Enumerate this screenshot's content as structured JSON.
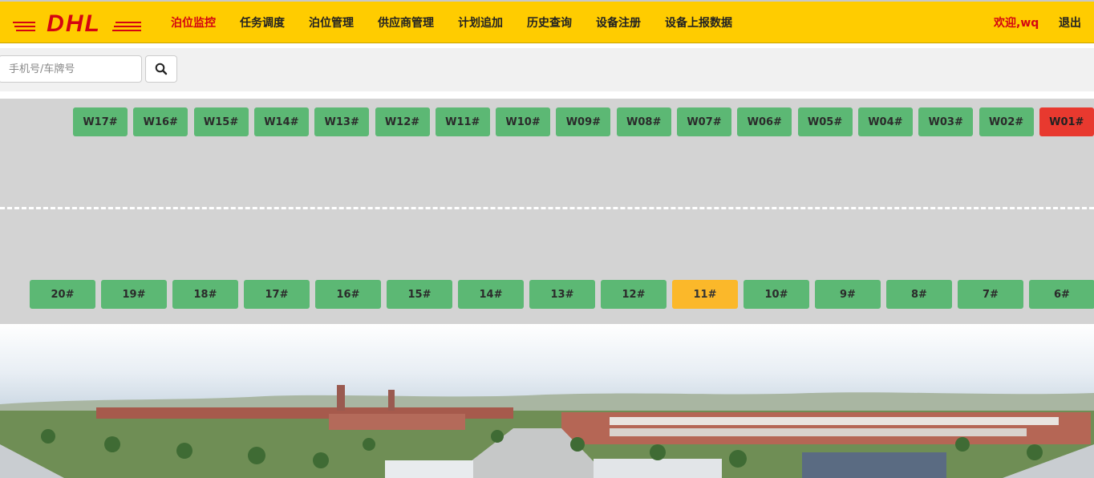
{
  "brand": {
    "logo_text": "DHL",
    "brand_yellow": "#ffcc00",
    "brand_red": "#d40511"
  },
  "nav": {
    "items": [
      {
        "label": "泊位监控",
        "active": true
      },
      {
        "label": "任务调度",
        "active": false
      },
      {
        "label": "泊位管理",
        "active": false
      },
      {
        "label": "供应商管理",
        "active": false
      },
      {
        "label": "计划追加",
        "active": false
      },
      {
        "label": "历史查询",
        "active": false
      },
      {
        "label": "设备注册",
        "active": false
      },
      {
        "label": "设备上报数据",
        "active": false
      }
    ],
    "welcome": "欢迎,wq",
    "logout": "退出"
  },
  "search": {
    "placeholder": "手机号/车牌号",
    "value": "",
    "button_icon": "search-icon"
  },
  "status_colors": {
    "free": "#5cb874",
    "occupied": "#e8392f",
    "pending": "#fbb82a"
  },
  "top_row": [
    {
      "label": "W17#",
      "status": "free"
    },
    {
      "label": "W16#",
      "status": "free"
    },
    {
      "label": "W15#",
      "status": "free"
    },
    {
      "label": "W14#",
      "status": "free"
    },
    {
      "label": "W13#",
      "status": "free"
    },
    {
      "label": "W12#",
      "status": "free"
    },
    {
      "label": "W11#",
      "status": "free"
    },
    {
      "label": "W10#",
      "status": "free"
    },
    {
      "label": "W09#",
      "status": "free"
    },
    {
      "label": "W08#",
      "status": "free"
    },
    {
      "label": "W07#",
      "status": "free"
    },
    {
      "label": "W06#",
      "status": "free"
    },
    {
      "label": "W05#",
      "status": "free"
    },
    {
      "label": "W04#",
      "status": "free"
    },
    {
      "label": "W03#",
      "status": "free"
    },
    {
      "label": "W02#",
      "status": "free"
    },
    {
      "label": "W01#",
      "status": "occupied"
    }
  ],
  "bottom_row": [
    {
      "label": "20#",
      "status": "free"
    },
    {
      "label": "19#",
      "status": "free"
    },
    {
      "label": "18#",
      "status": "free"
    },
    {
      "label": "17#",
      "status": "free"
    },
    {
      "label": "16#",
      "status": "free"
    },
    {
      "label": "15#",
      "status": "free"
    },
    {
      "label": "14#",
      "status": "free"
    },
    {
      "label": "13#",
      "status": "free"
    },
    {
      "label": "12#",
      "status": "free"
    },
    {
      "label": "11#",
      "status": "pending"
    },
    {
      "label": "10#",
      "status": "free"
    },
    {
      "label": "9#",
      "status": "free"
    },
    {
      "label": "8#",
      "status": "free"
    },
    {
      "label": "7#",
      "status": "free"
    },
    {
      "label": "6#",
      "status": "free"
    }
  ]
}
